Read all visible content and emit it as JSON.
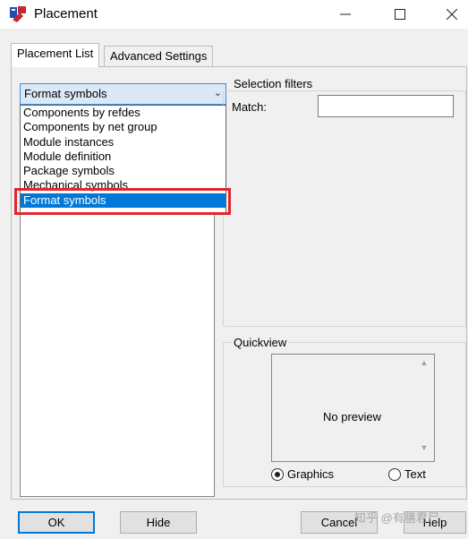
{
  "window": {
    "title": "Placement"
  },
  "tabs": [
    {
      "label": "Placement List",
      "active": true
    },
    {
      "label": "Advanced Settings",
      "active": false
    }
  ],
  "combo": {
    "selected": "Format symbols"
  },
  "dropdown": {
    "items": [
      "Components by refdes",
      "Components by net group",
      "Module instances",
      "Module definition",
      "Package symbols",
      "Mechanical symbols",
      "Format symbols"
    ],
    "selected_index": 6
  },
  "selection_filters": {
    "label": "Selection filters",
    "match_label": "Match:",
    "match_value": ""
  },
  "quickview": {
    "label": "Quickview",
    "preview_text": "No preview",
    "radio_graphics": "Graphics",
    "radio_text": "Text",
    "selected": "Graphics"
  },
  "buttons": {
    "ok": "OK",
    "hide": "Hide",
    "cancel": "Cancel",
    "help": "Help"
  },
  "watermark": "知乎 @有膳君尸",
  "colors": {
    "highlight": "#e0262e",
    "selection": "#0078d7"
  }
}
